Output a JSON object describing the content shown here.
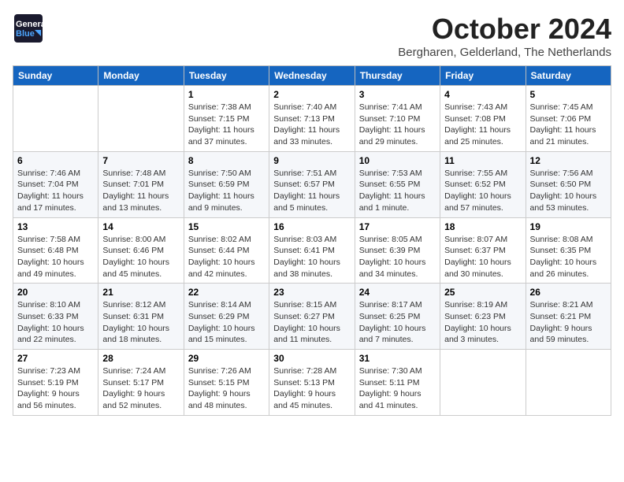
{
  "header": {
    "logo_line1": "General",
    "logo_line2": "Blue",
    "title": "October 2024",
    "subtitle": "Bergharen, Gelderland, The Netherlands"
  },
  "weekdays": [
    "Sunday",
    "Monday",
    "Tuesday",
    "Wednesday",
    "Thursday",
    "Friday",
    "Saturday"
  ],
  "weeks": [
    [
      {
        "day": "",
        "info": ""
      },
      {
        "day": "",
        "info": ""
      },
      {
        "day": "1",
        "info": "Sunrise: 7:38 AM\nSunset: 7:15 PM\nDaylight: 11 hours and 37 minutes."
      },
      {
        "day": "2",
        "info": "Sunrise: 7:40 AM\nSunset: 7:13 PM\nDaylight: 11 hours and 33 minutes."
      },
      {
        "day": "3",
        "info": "Sunrise: 7:41 AM\nSunset: 7:10 PM\nDaylight: 11 hours and 29 minutes."
      },
      {
        "day": "4",
        "info": "Sunrise: 7:43 AM\nSunset: 7:08 PM\nDaylight: 11 hours and 25 minutes."
      },
      {
        "day": "5",
        "info": "Sunrise: 7:45 AM\nSunset: 7:06 PM\nDaylight: 11 hours and 21 minutes."
      }
    ],
    [
      {
        "day": "6",
        "info": "Sunrise: 7:46 AM\nSunset: 7:04 PM\nDaylight: 11 hours and 17 minutes."
      },
      {
        "day": "7",
        "info": "Sunrise: 7:48 AM\nSunset: 7:01 PM\nDaylight: 11 hours and 13 minutes."
      },
      {
        "day": "8",
        "info": "Sunrise: 7:50 AM\nSunset: 6:59 PM\nDaylight: 11 hours and 9 minutes."
      },
      {
        "day": "9",
        "info": "Sunrise: 7:51 AM\nSunset: 6:57 PM\nDaylight: 11 hours and 5 minutes."
      },
      {
        "day": "10",
        "info": "Sunrise: 7:53 AM\nSunset: 6:55 PM\nDaylight: 11 hours and 1 minute."
      },
      {
        "day": "11",
        "info": "Sunrise: 7:55 AM\nSunset: 6:52 PM\nDaylight: 10 hours and 57 minutes."
      },
      {
        "day": "12",
        "info": "Sunrise: 7:56 AM\nSunset: 6:50 PM\nDaylight: 10 hours and 53 minutes."
      }
    ],
    [
      {
        "day": "13",
        "info": "Sunrise: 7:58 AM\nSunset: 6:48 PM\nDaylight: 10 hours and 49 minutes."
      },
      {
        "day": "14",
        "info": "Sunrise: 8:00 AM\nSunset: 6:46 PM\nDaylight: 10 hours and 45 minutes."
      },
      {
        "day": "15",
        "info": "Sunrise: 8:02 AM\nSunset: 6:44 PM\nDaylight: 10 hours and 42 minutes."
      },
      {
        "day": "16",
        "info": "Sunrise: 8:03 AM\nSunset: 6:41 PM\nDaylight: 10 hours and 38 minutes."
      },
      {
        "day": "17",
        "info": "Sunrise: 8:05 AM\nSunset: 6:39 PM\nDaylight: 10 hours and 34 minutes."
      },
      {
        "day": "18",
        "info": "Sunrise: 8:07 AM\nSunset: 6:37 PM\nDaylight: 10 hours and 30 minutes."
      },
      {
        "day": "19",
        "info": "Sunrise: 8:08 AM\nSunset: 6:35 PM\nDaylight: 10 hours and 26 minutes."
      }
    ],
    [
      {
        "day": "20",
        "info": "Sunrise: 8:10 AM\nSunset: 6:33 PM\nDaylight: 10 hours and 22 minutes."
      },
      {
        "day": "21",
        "info": "Sunrise: 8:12 AM\nSunset: 6:31 PM\nDaylight: 10 hours and 18 minutes."
      },
      {
        "day": "22",
        "info": "Sunrise: 8:14 AM\nSunset: 6:29 PM\nDaylight: 10 hours and 15 minutes."
      },
      {
        "day": "23",
        "info": "Sunrise: 8:15 AM\nSunset: 6:27 PM\nDaylight: 10 hours and 11 minutes."
      },
      {
        "day": "24",
        "info": "Sunrise: 8:17 AM\nSunset: 6:25 PM\nDaylight: 10 hours and 7 minutes."
      },
      {
        "day": "25",
        "info": "Sunrise: 8:19 AM\nSunset: 6:23 PM\nDaylight: 10 hours and 3 minutes."
      },
      {
        "day": "26",
        "info": "Sunrise: 8:21 AM\nSunset: 6:21 PM\nDaylight: 9 hours and 59 minutes."
      }
    ],
    [
      {
        "day": "27",
        "info": "Sunrise: 7:23 AM\nSunset: 5:19 PM\nDaylight: 9 hours and 56 minutes."
      },
      {
        "day": "28",
        "info": "Sunrise: 7:24 AM\nSunset: 5:17 PM\nDaylight: 9 hours and 52 minutes."
      },
      {
        "day": "29",
        "info": "Sunrise: 7:26 AM\nSunset: 5:15 PM\nDaylight: 9 hours and 48 minutes."
      },
      {
        "day": "30",
        "info": "Sunrise: 7:28 AM\nSunset: 5:13 PM\nDaylight: 9 hours and 45 minutes."
      },
      {
        "day": "31",
        "info": "Sunrise: 7:30 AM\nSunset: 5:11 PM\nDaylight: 9 hours and 41 minutes."
      },
      {
        "day": "",
        "info": ""
      },
      {
        "day": "",
        "info": ""
      }
    ]
  ]
}
